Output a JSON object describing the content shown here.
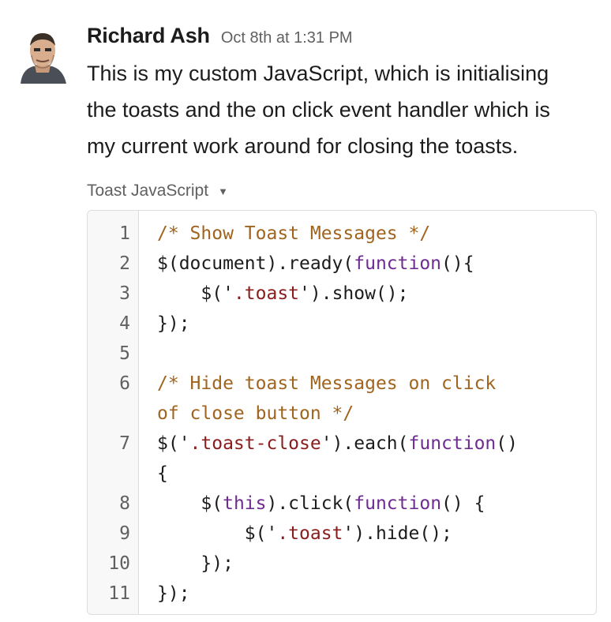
{
  "message": {
    "author": "Richard Ash",
    "timestamp": "Oct 8th at 1:31 PM",
    "text_lines": [
      "This is my custom JavaScript, which is initialising",
      "the toasts and the on click event handler which is",
      "my current work around for closing the toasts."
    ],
    "avatar_icon": "user-avatar-icon"
  },
  "snippet": {
    "title": "Toast JavaScript",
    "caret_icon": "caret-down-icon",
    "lines": [
      {
        "num": "1",
        "code": "/* Show Toast Messages */"
      },
      {
        "num": "2",
        "code": "$(document).ready(function(){"
      },
      {
        "num": "3",
        "code": "    $('.toast').show();"
      },
      {
        "num": "4",
        "code": "});"
      },
      {
        "num": "5",
        "code": ""
      },
      {
        "num": "6",
        "code": "/* Hide toast Messages on click"
      },
      {
        "num": "",
        "code": "of close button */"
      },
      {
        "num": "7",
        "code": "$('.toast-close').each(function()"
      },
      {
        "num": "",
        "code": "{"
      },
      {
        "num": "8",
        "code": "    $(this).click(function() {"
      },
      {
        "num": "9",
        "code": "        $('.toast').hide();"
      },
      {
        "num": "10",
        "code": "    });"
      },
      {
        "num": "11",
        "code": "});"
      }
    ]
  },
  "colors": {
    "comment": "#a0641e",
    "keyword": "#6e2b91",
    "string": "#8a1c1c",
    "text": "#1d1c1d",
    "muted": "#616061"
  }
}
